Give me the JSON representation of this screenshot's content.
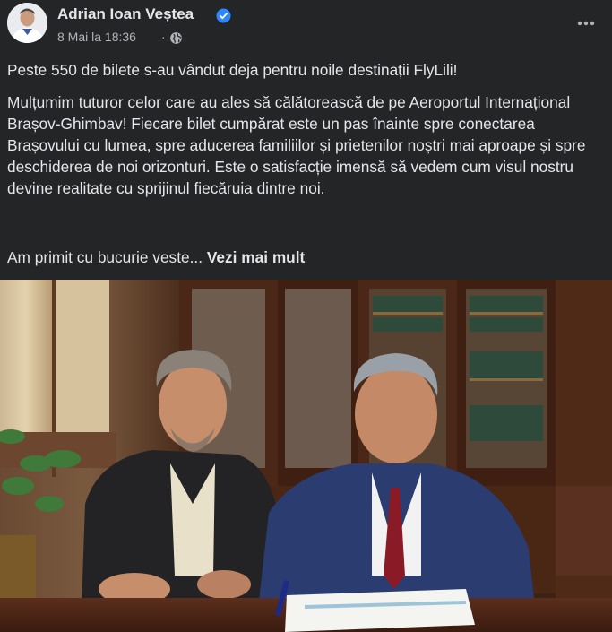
{
  "post": {
    "author": "Adrian Ioan Veștea",
    "date": "8 Mai la 18:36",
    "separator": "·",
    "privacy_icon": "globe-icon",
    "verified_icon": "verified-badge-icon",
    "more_icon": "more-options-icon",
    "paragraph_1": "Peste 550 de bilete s-au vândut deja pentru noile destinații FlyLili!",
    "paragraph_2": "Mulțumim tuturor celor care au ales să călătorească de pe Aeroportul Internațional Brașov-Ghimbav! Fiecare bilet cumpărat este un pas înainte spre conectarea Brașovului cu lumea, spre aducerea familiilor și prietenilor noștri mai aproape și spre deschiderea de noi orizonturi. Este o satisfacție imensă să vedem cum visul nostru devine realitate cu sprijinul fiecăruia dintre noi.",
    "paragraph_3": "Am primit cu bucurie veste... ",
    "see_more": "Vezi mai mult"
  },
  "colors": {
    "background": "#242526",
    "text": "#e4e6eb",
    "secondary_text": "#b0b3b8",
    "verified": "#2d88ff"
  }
}
